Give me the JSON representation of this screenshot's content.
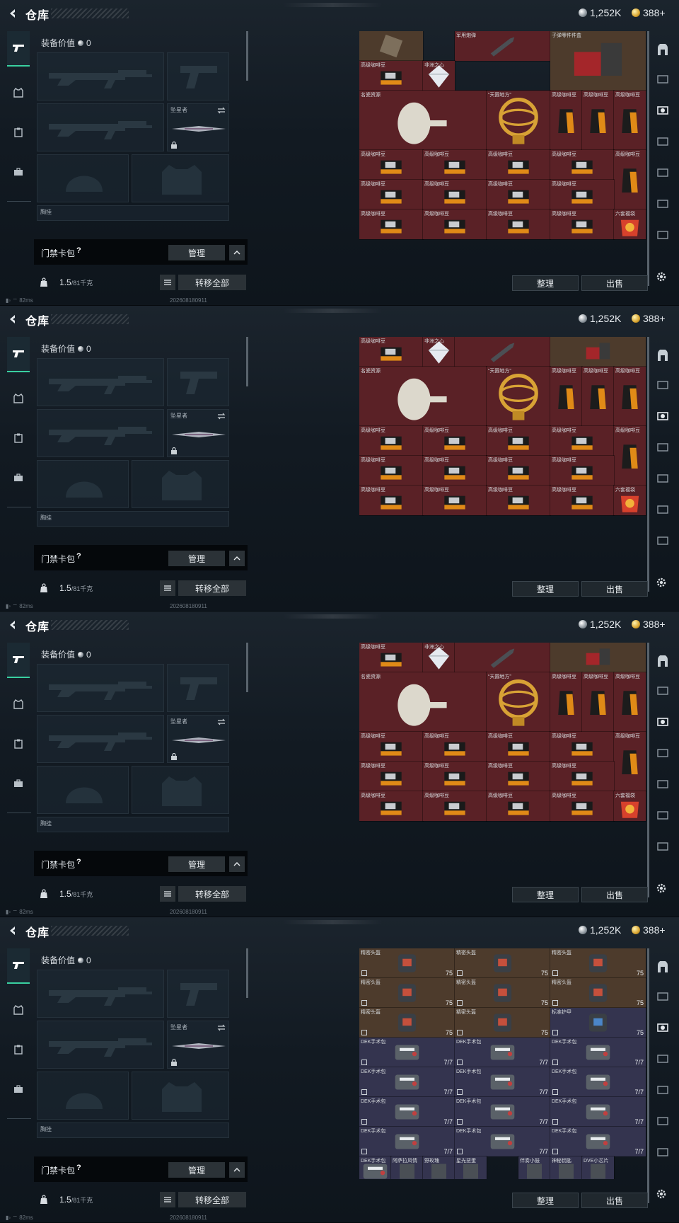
{
  "header": {
    "title": "仓库",
    "silver": "1,252K",
    "gold": "388+"
  },
  "equipment": {
    "value_label": "装备价值",
    "value": "0",
    "melee_label": "坠星者",
    "bottom_label": "胸挂"
  },
  "badge_bag": {
    "label": "门禁卡包",
    "help": "?",
    "manage": "管理"
  },
  "weight": {
    "value": "1.5",
    "capacity": "/81千克",
    "transfer": "转移全部"
  },
  "status": {
    "ping": "82ms",
    "code": "202608180911"
  },
  "actions": {
    "sort": "整理",
    "sell": "出售"
  },
  "colors": {
    "accent": "#39d0a0",
    "storage_red": "#5a2126",
    "storage_purple": "#34344f",
    "storage_brown": "#4d3b2c"
  },
  "storage_pages": [
    {
      "cells": [
        {
          "name": "",
          "icon": "antique-icon",
          "color": "brown",
          "col": 0,
          "row": 0,
          "w": 2,
          "h": 1
        },
        {
          "name": "军用炮弹",
          "icon": "shell-icon",
          "color": "red",
          "col": 3,
          "row": 0,
          "w": 3,
          "h": 1
        },
        {
          "name": "子弹零件件盒",
          "icon": "parts-box-icon",
          "color": "brown",
          "col": 6,
          "row": 0,
          "w": 3,
          "h": 2
        },
        {
          "name": "高级咖啡豆",
          "icon": "coffee-box-icon",
          "color": "red",
          "col": 0,
          "row": 1,
          "w": 2,
          "h": 1
        },
        {
          "name": "非洲之心",
          "icon": "diamond-icon",
          "color": "red",
          "col": 2,
          "row": 1,
          "w": 1,
          "h": 1
        },
        {
          "name": "名瓷资源",
          "icon": "vase-icon",
          "color": "red",
          "col": 0,
          "row": 2,
          "w": 4,
          "h": 2
        },
        {
          "name": "“天圆地方”",
          "icon": "armillary-icon",
          "color": "red",
          "col": 4,
          "row": 2,
          "w": 2,
          "h": 2
        },
        {
          "name": "高级咖啡豆",
          "icon": "coffee-bag-icon",
          "color": "red",
          "col": 6,
          "row": 2,
          "w": 1,
          "h": 2
        },
        {
          "name": "高级咖啡豆",
          "icon": "coffee-bag-icon",
          "color": "red",
          "col": 7,
          "row": 2,
          "w": 1,
          "h": 2
        },
        {
          "name": "高级咖啡豆",
          "icon": "coffee-bag-icon",
          "color": "red",
          "col": 8,
          "row": 2,
          "w": 1,
          "h": 2
        },
        {
          "name": "高级咖啡豆",
          "icon": "coffee-box-icon",
          "color": "red",
          "col": 0,
          "row": 4,
          "w": 2,
          "h": 1
        },
        {
          "name": "高级咖啡豆",
          "icon": "coffee-box-icon",
          "color": "red",
          "col": 2,
          "row": 4,
          "w": 2,
          "h": 1
        },
        {
          "name": "高级咖啡豆",
          "icon": "coffee-box-icon",
          "color": "red",
          "col": 4,
          "row": 4,
          "w": 2,
          "h": 1
        },
        {
          "name": "高级咖啡豆",
          "icon": "coffee-box-icon",
          "color": "red",
          "col": 6,
          "row": 4,
          "w": 2,
          "h": 1
        },
        {
          "name": "高级咖啡豆",
          "icon": "coffee-bag-icon",
          "color": "red",
          "col": 8,
          "row": 4,
          "w": 1,
          "h": 2
        },
        {
          "name": "高级咖啡豆",
          "icon": "coffee-box-icon",
          "color": "red",
          "col": 0,
          "row": 5,
          "w": 2,
          "h": 1
        },
        {
          "name": "高级咖啡豆",
          "icon": "coffee-box-icon",
          "color": "red",
          "col": 2,
          "row": 5,
          "w": 2,
          "h": 1
        },
        {
          "name": "高级咖啡豆",
          "icon": "coffee-box-icon",
          "color": "red",
          "col": 4,
          "row": 5,
          "w": 2,
          "h": 1
        },
        {
          "name": "高级咖啡豆",
          "icon": "coffee-box-icon",
          "color": "red",
          "col": 6,
          "row": 5,
          "w": 2,
          "h": 1
        },
        {
          "name": "高级咖啡豆",
          "icon": "coffee-box-icon",
          "color": "red",
          "col": 0,
          "row": 6,
          "w": 2,
          "h": 1
        },
        {
          "name": "高级咖啡豆",
          "icon": "coffee-box-icon",
          "color": "red",
          "col": 2,
          "row": 6,
          "w": 2,
          "h": 1
        },
        {
          "name": "高级咖啡豆",
          "icon": "coffee-box-icon",
          "color": "red",
          "col": 4,
          "row": 6,
          "w": 2,
          "h": 1
        },
        {
          "name": "高级咖啡豆",
          "icon": "coffee-box-icon",
          "color": "red",
          "col": 6,
          "row": 6,
          "w": 2,
          "h": 1
        },
        {
          "name": "六套福袋",
          "icon": "lucky-bag-icon",
          "color": "red",
          "col": 8,
          "row": 6,
          "w": 1,
          "h": 1
        }
      ]
    },
    {
      "cells": [
        {
          "name": "",
          "icon": "antique-icon",
          "color": "brown",
          "col": 0,
          "row": 0,
          "w": 2,
          "h": 1
        },
        {
          "name": "高级咖啡豆",
          "icon": "coffee-box-icon",
          "color": "red",
          "col": 0,
          "row": 0,
          "w": 2,
          "h": 1
        },
        {
          "name": "非洲之心",
          "icon": "diamond-icon",
          "color": "red",
          "col": 2,
          "row": 0,
          "w": 1,
          "h": 1
        },
        {
          "name": "",
          "icon": "shell-icon",
          "color": "red",
          "col": 3,
          "row": 0,
          "w": 3,
          "h": 1
        },
        {
          "name": "",
          "icon": "parts-box-icon",
          "color": "brown",
          "col": 6,
          "row": 0,
          "w": 3,
          "h": 1
        },
        {
          "name": "名瓷资源",
          "icon": "vase-icon",
          "color": "red",
          "col": 0,
          "row": 1,
          "w": 4,
          "h": 2
        },
        {
          "name": "“天圆地方”",
          "icon": "armillary-icon",
          "color": "red",
          "col": 4,
          "row": 1,
          "w": 2,
          "h": 2
        },
        {
          "name": "高级咖啡豆",
          "icon": "coffee-bag-icon",
          "color": "red",
          "col": 6,
          "row": 1,
          "w": 1,
          "h": 2
        },
        {
          "name": "高级咖啡豆",
          "icon": "coffee-bag-icon",
          "color": "red",
          "col": 7,
          "row": 1,
          "w": 1,
          "h": 2
        },
        {
          "name": "高级咖啡豆",
          "icon": "coffee-bag-icon",
          "color": "red",
          "col": 8,
          "row": 1,
          "w": 1,
          "h": 2
        },
        {
          "name": "高级咖啡豆",
          "icon": "coffee-box-icon",
          "color": "red",
          "col": 0,
          "row": 3,
          "w": 2,
          "h": 1
        },
        {
          "name": "高级咖啡豆",
          "icon": "coffee-box-icon",
          "color": "red",
          "col": 2,
          "row": 3,
          "w": 2,
          "h": 1
        },
        {
          "name": "高级咖啡豆",
          "icon": "coffee-box-icon",
          "color": "red",
          "col": 4,
          "row": 3,
          "w": 2,
          "h": 1
        },
        {
          "name": "高级咖啡豆",
          "icon": "coffee-box-icon",
          "color": "red",
          "col": 6,
          "row": 3,
          "w": 2,
          "h": 1
        },
        {
          "name": "高级咖啡豆",
          "icon": "coffee-bag-icon",
          "color": "red",
          "col": 8,
          "row": 3,
          "w": 1,
          "h": 2
        },
        {
          "name": "高级咖啡豆",
          "icon": "coffee-box-icon",
          "color": "red",
          "col": 0,
          "row": 4,
          "w": 2,
          "h": 1
        },
        {
          "name": "高级咖啡豆",
          "icon": "coffee-box-icon",
          "color": "red",
          "col": 2,
          "row": 4,
          "w": 2,
          "h": 1
        },
        {
          "name": "高级咖啡豆",
          "icon": "coffee-box-icon",
          "color": "red",
          "col": 4,
          "row": 4,
          "w": 2,
          "h": 1
        },
        {
          "name": "高级咖啡豆",
          "icon": "coffee-box-icon",
          "color": "red",
          "col": 6,
          "row": 4,
          "w": 2,
          "h": 1
        },
        {
          "name": "高级咖啡豆",
          "icon": "coffee-box-icon",
          "color": "red",
          "col": 0,
          "row": 5,
          "w": 2,
          "h": 1
        },
        {
          "name": "高级咖啡豆",
          "icon": "coffee-box-icon",
          "color": "red",
          "col": 2,
          "row": 5,
          "w": 2,
          "h": 1
        },
        {
          "name": "高级咖啡豆",
          "icon": "coffee-box-icon",
          "color": "red",
          "col": 4,
          "row": 5,
          "w": 2,
          "h": 1
        },
        {
          "name": "高级咖啡豆",
          "icon": "coffee-box-icon",
          "color": "red",
          "col": 6,
          "row": 5,
          "w": 2,
          "h": 1
        },
        {
          "name": "六套福袋",
          "icon": "lucky-bag-icon",
          "color": "red",
          "col": 8,
          "row": 5,
          "w": 1,
          "h": 1
        }
      ]
    },
    {
      "cells": [
        {
          "name": "高级咖啡豆",
          "icon": "coffee-box-icon",
          "color": "red",
          "col": 0,
          "row": 0,
          "w": 2,
          "h": 1
        },
        {
          "name": "非洲之心",
          "icon": "diamond-icon",
          "color": "red",
          "col": 2,
          "row": 0,
          "w": 1,
          "h": 1
        },
        {
          "name": "",
          "icon": "shell-icon",
          "color": "red",
          "col": 3,
          "row": 0,
          "w": 3,
          "h": 1
        },
        {
          "name": "",
          "icon": "parts-box-icon",
          "color": "brown",
          "col": 6,
          "row": 0,
          "w": 3,
          "h": 1
        },
        {
          "name": "名瓷资源",
          "icon": "vase-icon",
          "color": "red",
          "col": 0,
          "row": 1,
          "w": 4,
          "h": 2
        },
        {
          "name": "“天圆地方”",
          "icon": "armillary-icon",
          "color": "red",
          "col": 4,
          "row": 1,
          "w": 2,
          "h": 2
        },
        {
          "name": "高级咖啡豆",
          "icon": "coffee-bag-icon",
          "color": "red",
          "col": 6,
          "row": 1,
          "w": 1,
          "h": 2
        },
        {
          "name": "高级咖啡豆",
          "icon": "coffee-bag-icon",
          "color": "red",
          "col": 7,
          "row": 1,
          "w": 1,
          "h": 2
        },
        {
          "name": "高级咖啡豆",
          "icon": "coffee-bag-icon",
          "color": "red",
          "col": 8,
          "row": 1,
          "w": 1,
          "h": 2
        },
        {
          "name": "高级咖啡豆",
          "icon": "coffee-box-icon",
          "color": "red",
          "col": 0,
          "row": 3,
          "w": 2,
          "h": 1
        },
        {
          "name": "高级咖啡豆",
          "icon": "coffee-box-icon",
          "color": "red",
          "col": 2,
          "row": 3,
          "w": 2,
          "h": 1
        },
        {
          "name": "高级咖啡豆",
          "icon": "coffee-box-icon",
          "color": "red",
          "col": 4,
          "row": 3,
          "w": 2,
          "h": 1
        },
        {
          "name": "高级咖啡豆",
          "icon": "coffee-box-icon",
          "color": "red",
          "col": 6,
          "row": 3,
          "w": 2,
          "h": 1
        },
        {
          "name": "高级咖啡豆",
          "icon": "coffee-bag-icon",
          "color": "red",
          "col": 8,
          "row": 3,
          "w": 1,
          "h": 2
        },
        {
          "name": "高级咖啡豆",
          "icon": "coffee-box-icon",
          "color": "red",
          "col": 0,
          "row": 4,
          "w": 2,
          "h": 1
        },
        {
          "name": "高级咖啡豆",
          "icon": "coffee-box-icon",
          "color": "red",
          "col": 2,
          "row": 4,
          "w": 2,
          "h": 1
        },
        {
          "name": "高级咖啡豆",
          "icon": "coffee-box-icon",
          "color": "red",
          "col": 4,
          "row": 4,
          "w": 2,
          "h": 1
        },
        {
          "name": "高级咖啡豆",
          "icon": "coffee-box-icon",
          "color": "red",
          "col": 6,
          "row": 4,
          "w": 2,
          "h": 1
        },
        {
          "name": "高级咖啡豆",
          "icon": "coffee-box-icon",
          "color": "red",
          "col": 0,
          "row": 5,
          "w": 2,
          "h": 1
        },
        {
          "name": "高级咖啡豆",
          "icon": "coffee-box-icon",
          "color": "red",
          "col": 2,
          "row": 5,
          "w": 2,
          "h": 1
        },
        {
          "name": "高级咖啡豆",
          "icon": "coffee-box-icon",
          "color": "red",
          "col": 4,
          "row": 5,
          "w": 2,
          "h": 1
        },
        {
          "name": "高级咖啡豆",
          "icon": "coffee-box-icon",
          "color": "red",
          "col": 6,
          "row": 5,
          "w": 2,
          "h": 1
        },
        {
          "name": "六套福袋",
          "icon": "lucky-bag-icon",
          "color": "red",
          "col": 8,
          "row": 5,
          "w": 1,
          "h": 1
        }
      ]
    },
    {
      "cells": [
        {
          "name": "精密头盔",
          "icon": "helmet-icon",
          "color": "brown",
          "col": 0,
          "row": 0,
          "w": 3,
          "h": 1,
          "count": "75"
        },
        {
          "name": "精密头盔",
          "icon": "helmet-icon",
          "color": "brown",
          "col": 3,
          "row": 0,
          "w": 3,
          "h": 1,
          "count": "75"
        },
        {
          "name": "精密头盔",
          "icon": "helmet-icon",
          "color": "brown",
          "col": 6,
          "row": 0,
          "w": 3,
          "h": 1,
          "count": "75"
        },
        {
          "name": "精密头盔",
          "icon": "helmet-icon",
          "color": "brown",
          "col": 0,
          "row": 1,
          "w": 3,
          "h": 1,
          "count": "75"
        },
        {
          "name": "精密头盔",
          "icon": "helmet-icon",
          "color": "brown",
          "col": 3,
          "row": 1,
          "w": 3,
          "h": 1,
          "count": "75"
        },
        {
          "name": "精密头盔",
          "icon": "helmet-icon",
          "color": "brown",
          "col": 6,
          "row": 1,
          "w": 3,
          "h": 1,
          "count": "75"
        },
        {
          "name": "精密头盔",
          "icon": "helmet-icon",
          "color": "brown",
          "col": 0,
          "row": 2,
          "w": 3,
          "h": 1,
          "count": "75"
        },
        {
          "name": "精密头盔",
          "icon": "helmet-icon",
          "color": "brown",
          "col": 3,
          "row": 2,
          "w": 3,
          "h": 1,
          "count": "75"
        },
        {
          "name": "标准护甲",
          "icon": "armor-icon",
          "color": "purple",
          "col": 6,
          "row": 2,
          "w": 3,
          "h": 1,
          "count": "75"
        },
        {
          "name": "DEK手术包",
          "icon": "surgery-kit-icon",
          "color": "purple",
          "col": 0,
          "row": 3,
          "w": 3,
          "h": 1,
          "count": "7/7"
        },
        {
          "name": "DEK手术包",
          "icon": "surgery-kit-icon",
          "color": "purple",
          "col": 3,
          "row": 3,
          "w": 3,
          "h": 1,
          "count": "7/7"
        },
        {
          "name": "DEK手术包",
          "icon": "surgery-kit-icon",
          "color": "purple",
          "col": 6,
          "row": 3,
          "w": 3,
          "h": 1,
          "count": "7/7"
        },
        {
          "name": "DEK手术包",
          "icon": "surgery-kit-icon",
          "color": "purple",
          "col": 0,
          "row": 4,
          "w": 3,
          "h": 1,
          "count": "7/7"
        },
        {
          "name": "DEK手术包",
          "icon": "surgery-kit-icon",
          "color": "purple",
          "col": 3,
          "row": 4,
          "w": 3,
          "h": 1,
          "count": "7/7"
        },
        {
          "name": "DEK手术包",
          "icon": "surgery-kit-icon",
          "color": "purple",
          "col": 6,
          "row": 4,
          "w": 3,
          "h": 1,
          "count": "7/7"
        },
        {
          "name": "DEK手术包",
          "icon": "surgery-kit-icon",
          "color": "purple",
          "col": 0,
          "row": 5,
          "w": 3,
          "h": 1,
          "count": "7/7"
        },
        {
          "name": "DEK手术包",
          "icon": "surgery-kit-icon",
          "color": "purple",
          "col": 3,
          "row": 5,
          "w": 3,
          "h": 1,
          "count": "7/7"
        },
        {
          "name": "DEK手术包",
          "icon": "surgery-kit-icon",
          "color": "purple",
          "col": 6,
          "row": 5,
          "w": 3,
          "h": 1,
          "count": "7/7"
        },
        {
          "name": "DEK手术包",
          "icon": "surgery-kit-icon",
          "color": "purple",
          "col": 0,
          "row": 6,
          "w": 3,
          "h": 1,
          "count": "7/7"
        },
        {
          "name": "DEK手术包",
          "icon": "surgery-kit-icon",
          "color": "purple",
          "col": 3,
          "row": 6,
          "w": 3,
          "h": 1,
          "count": "7/7"
        },
        {
          "name": "DEK手术包",
          "icon": "surgery-kit-icon",
          "color": "purple",
          "col": 6,
          "row": 6,
          "w": 3,
          "h": 1,
          "count": "7/7"
        },
        {
          "name": "DEK手术包",
          "icon": "surgery-kit-icon",
          "color": "purple",
          "col": 0,
          "row": 7,
          "w": 1,
          "h": 1
        },
        {
          "name": "阿萨拉风情",
          "icon": "misc-item-icon",
          "color": "purple",
          "col": 1,
          "row": 7,
          "w": 1,
          "h": 1
        },
        {
          "name": "野玫瑰",
          "icon": "misc-item-icon",
          "color": "purple",
          "col": 2,
          "row": 7,
          "w": 1,
          "h": 1
        },
        {
          "name": "星光扭蛋",
          "icon": "misc-item-icon",
          "color": "purple",
          "col": 3,
          "row": 7,
          "w": 1,
          "h": 1
        },
        {
          "name": "伴奏小鼓",
          "icon": "misc-item-icon",
          "color": "purple",
          "col": 5,
          "row": 7,
          "w": 1,
          "h": 1
        },
        {
          "name": "神秘钥匙",
          "icon": "misc-item-icon",
          "color": "purple",
          "col": 6,
          "row": 7,
          "w": 1,
          "h": 1
        },
        {
          "name": "DVE小芯片",
          "icon": "misc-item-icon",
          "color": "purple",
          "col": 7,
          "row": 7,
          "w": 1,
          "h": 1
        }
      ]
    }
  ]
}
